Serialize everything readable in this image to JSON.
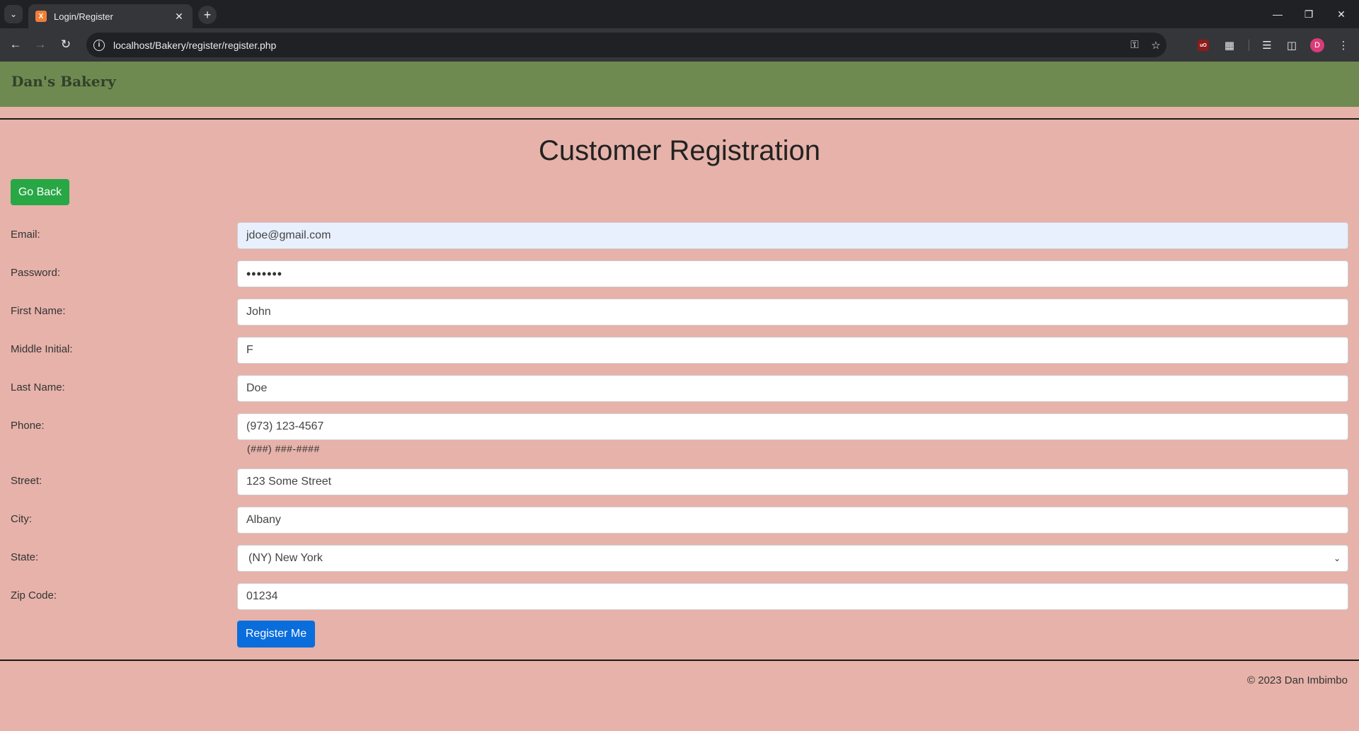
{
  "browser": {
    "tab_title": "Login/Register",
    "tab_favicon_letter": "X",
    "url": "localhost/Bakery/register/register.php",
    "profile_initial": "D"
  },
  "site": {
    "brand": "Dan's Bakery"
  },
  "page": {
    "title": "Customer Registration",
    "back_label": "Go Back",
    "register_label": "Register Me"
  },
  "form": {
    "email": {
      "label": "Email:",
      "value": "jdoe@gmail.com"
    },
    "password": {
      "label": "Password:",
      "value": "•••••••"
    },
    "first_name": {
      "label": "First Name:",
      "value": "John"
    },
    "middle_initial": {
      "label": "Middle Initial:",
      "value": "F"
    },
    "last_name": {
      "label": "Last Name:",
      "value": "Doe"
    },
    "phone": {
      "label": "Phone:",
      "value": "(973) 123-4567",
      "hint": "(###) ###-####"
    },
    "street": {
      "label": "Street:",
      "value": "123 Some Street"
    },
    "city": {
      "label": "City:",
      "value": "Albany"
    },
    "state": {
      "label": "State:",
      "value": "(NY) New York"
    },
    "zip": {
      "label": "Zip Code:",
      "value": "01234"
    }
  },
  "footer": {
    "copyright": "© 2023 Dan Imbimbo"
  }
}
